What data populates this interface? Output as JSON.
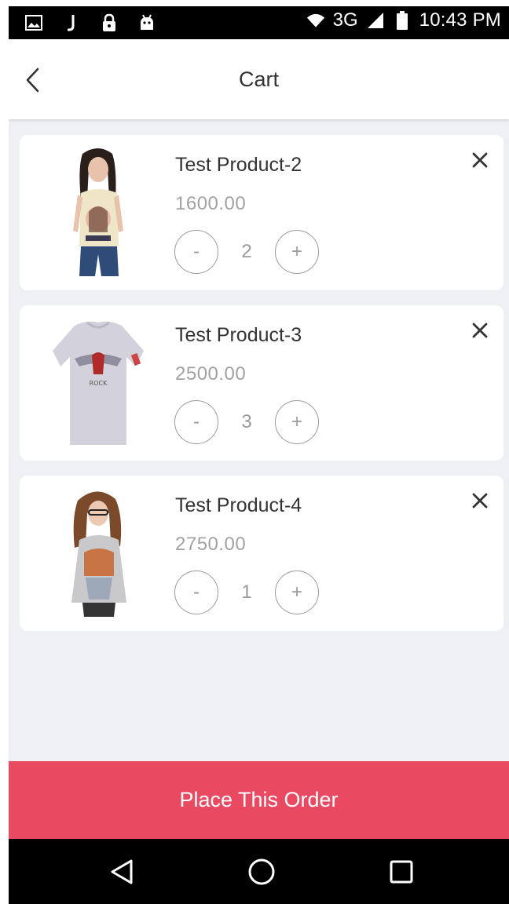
{
  "status_bar": {
    "network": "3G",
    "time": "10:43 PM",
    "icons": [
      "gallery-icon",
      "j-notification-icon",
      "lock-icon",
      "android-icon",
      "wifi-icon",
      "signal-icon",
      "battery-icon"
    ]
  },
  "header": {
    "title": "Cart",
    "back_icon": "chevron-left-icon"
  },
  "cart": {
    "items": [
      {
        "name": "Test Product-2",
        "price": "1600.00",
        "quantity": "2",
        "decrement_label": "-",
        "increment_label": "+"
      },
      {
        "name": "Test Product-3",
        "price": "2500.00",
        "quantity": "3",
        "decrement_label": "-",
        "increment_label": "+"
      },
      {
        "name": "Test Product-4",
        "price": "2750.00",
        "quantity": "1",
        "decrement_label": "-",
        "increment_label": "+"
      }
    ]
  },
  "footer": {
    "order_button_label": "Place This Order"
  },
  "colors": {
    "accent": "#e94a62",
    "background": "#eff0f4",
    "card": "#ffffff",
    "muted_text": "#a2a2a2"
  }
}
